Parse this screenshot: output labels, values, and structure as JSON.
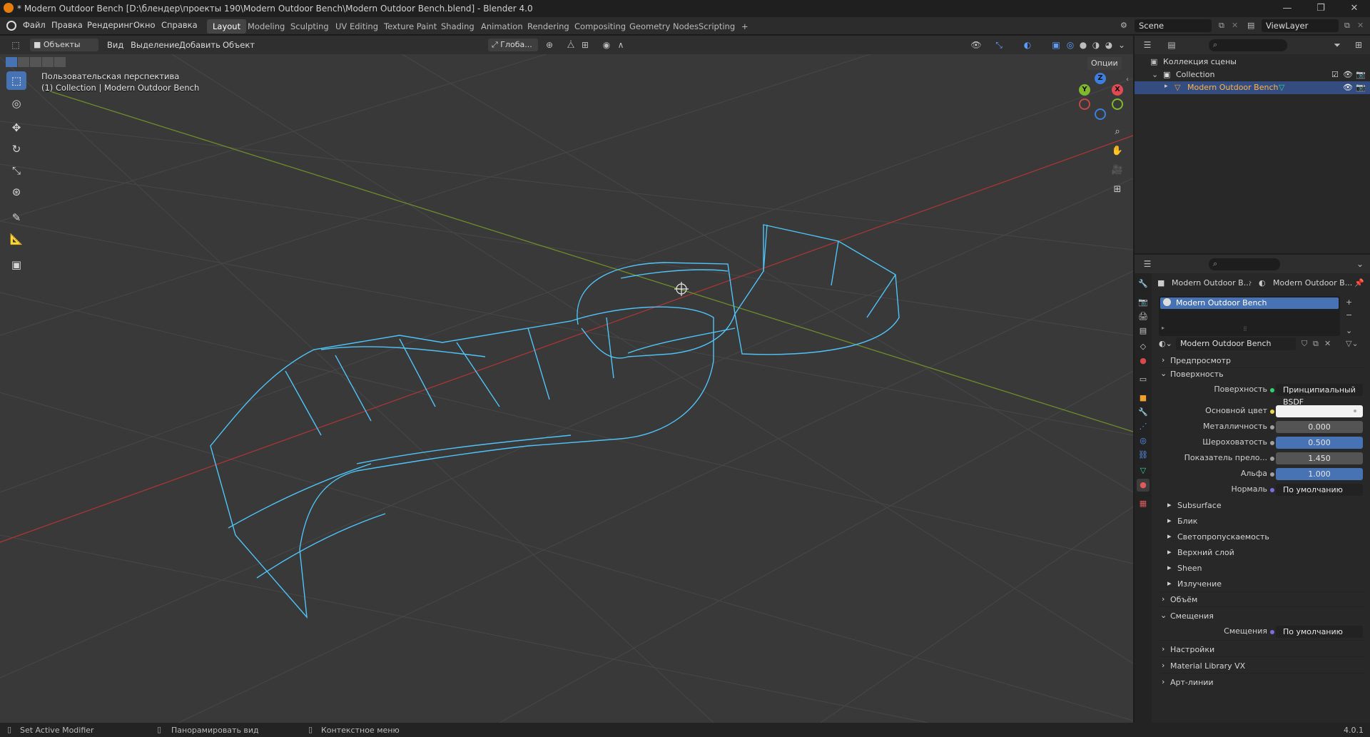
{
  "window": {
    "title": "* Modern Outdoor Bench [D:\\блендер\\проекты 190\\Modern Outdoor Bench\\Modern Outdoor Bench.blend] - Blender 4.0"
  },
  "menubar": {
    "menus": [
      "Файл",
      "Правка",
      "Рендеринг",
      "Окно",
      "Справка"
    ],
    "workspaces": [
      "Layout",
      "Modeling",
      "Sculpting",
      "UV Editing",
      "Texture Paint",
      "Shading",
      "Animation",
      "Rendering",
      "Compositing",
      "Geometry Nodes",
      "Scripting"
    ],
    "active_workspace": "Layout",
    "add_tab": "+",
    "scene": "Scene",
    "view_layer": "ViewLayer"
  },
  "viewport": {
    "mode": "Объекты",
    "menus": [
      "Вид",
      "Выделение",
      "Добавить",
      "Объект"
    ],
    "orientation": "Глоба...",
    "options": "Опции",
    "overlay_title": "Пользовательская перспектива",
    "overlay_subtitle": "(1) Collection | Modern Outdoor Bench",
    "gizmo_axes": [
      "X",
      "Y",
      "Z"
    ],
    "wire_color": "#4fc3f7",
    "grid_color": "#444444",
    "x_axis_color": "#b03a3a",
    "y_axis_color": "#6e8f2a"
  },
  "outliner": {
    "rows": [
      {
        "label": "Коллекция сцены",
        "level": 0
      },
      {
        "label": "Collection",
        "level": 1
      },
      {
        "label": "Modern Outdoor Bench",
        "level": 2,
        "selected": true
      }
    ]
  },
  "properties": {
    "breadcrumb_object": "Modern Outdoor B...",
    "breadcrumb_material": "Modern Outdoor B...",
    "slot_name": "Modern Outdoor Bench",
    "material_name": "Modern Outdoor Bench",
    "sections": {
      "preview": "Предпросмотр",
      "surface": "Поверхность",
      "volume": "Объём",
      "displacement": "Смещения",
      "settings": "Настройки",
      "material_library": "Material Library VX",
      "line_art": "Арт-линии"
    },
    "surface_label": "Поверхность",
    "surface_value": "Принципиальный BSDF",
    "params": [
      {
        "label": "Основной цвет",
        "value": "",
        "style": "white"
      },
      {
        "label": "Металличность",
        "value": "0.000",
        "style": "grey"
      },
      {
        "label": "Шероховатость",
        "value": "0.500",
        "style": "blue"
      },
      {
        "label": "Показатель прело...",
        "value": "1.450",
        "style": "grey"
      },
      {
        "label": "Альфа",
        "value": "1.000",
        "style": "blue"
      },
      {
        "label": "Нормаль",
        "value": "По умолчанию",
        "style": "dark"
      }
    ],
    "subpanels": [
      "Subsurface",
      "Блик",
      "Светопропускаемость",
      "Верхний слой",
      "Sheen",
      "Излучение"
    ],
    "displacement_label": "Смещения",
    "displacement_value": "По умолчанию"
  },
  "statusbar": {
    "items": [
      "Set Active Modifier",
      "Панорамировать вид",
      "Контекстное меню"
    ],
    "version": "4.0.1"
  }
}
